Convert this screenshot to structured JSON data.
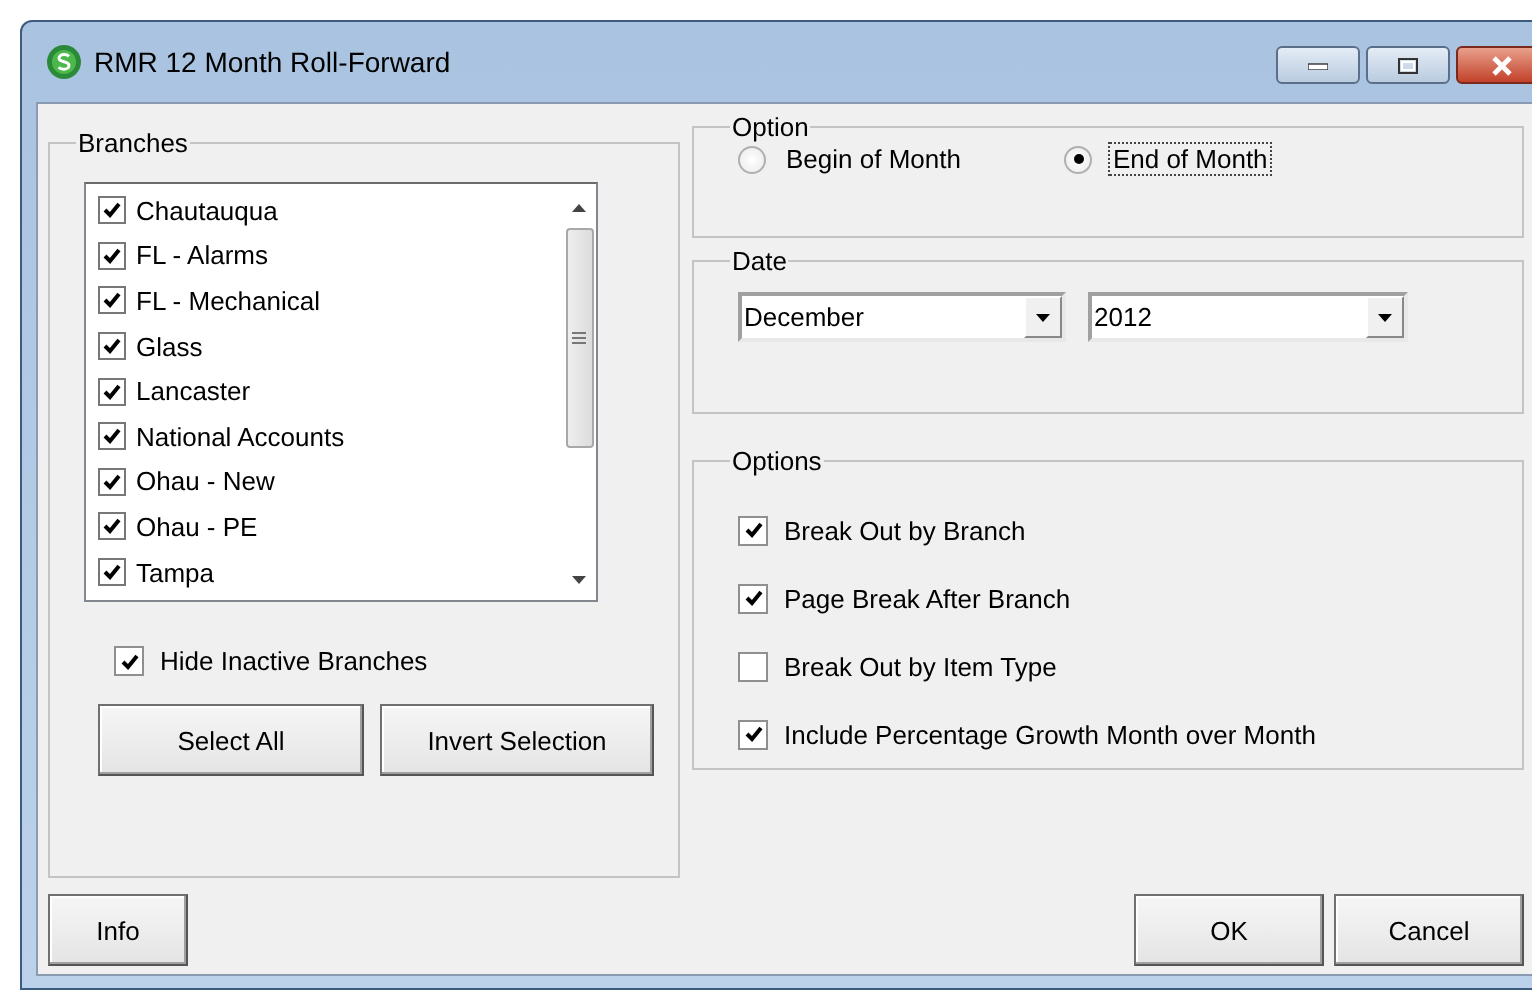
{
  "window": {
    "title": "RMR 12 Month Roll-Forward"
  },
  "branches": {
    "label": "Branches",
    "items": [
      {
        "name": "Chautauqua",
        "checked": true
      },
      {
        "name": "FL - Alarms",
        "checked": true
      },
      {
        "name": "FL - Mechanical",
        "checked": true
      },
      {
        "name": "Glass",
        "checked": true
      },
      {
        "name": "Lancaster",
        "checked": true
      },
      {
        "name": "National Accounts",
        "checked": true
      },
      {
        "name": "Ohau - New",
        "checked": true
      },
      {
        "name": "Ohau - PE",
        "checked": true
      },
      {
        "name": "Tampa",
        "checked": true
      }
    ],
    "hide_inactive": {
      "label": "Hide Inactive Branches",
      "checked": true
    },
    "buttons": [
      "Select All",
      "Invert Selection"
    ]
  },
  "option": {
    "label": "Option",
    "radios": [
      {
        "label": "Begin of Month",
        "selected": false
      },
      {
        "label": "End of Month",
        "selected": true
      }
    ]
  },
  "date": {
    "label": "Date",
    "month": "December",
    "year": "2012"
  },
  "options": {
    "label": "Options",
    "items": [
      {
        "label": "Break Out by Branch",
        "checked": true
      },
      {
        "label": "Page Break After Branch",
        "checked": true
      },
      {
        "label": "Break Out by Item Type",
        "checked": false
      },
      {
        "label": "Include Percentage Growth Month over Month",
        "checked": true
      }
    ]
  },
  "footer": {
    "info": "Info",
    "ok": "OK",
    "cancel": "Cancel"
  }
}
